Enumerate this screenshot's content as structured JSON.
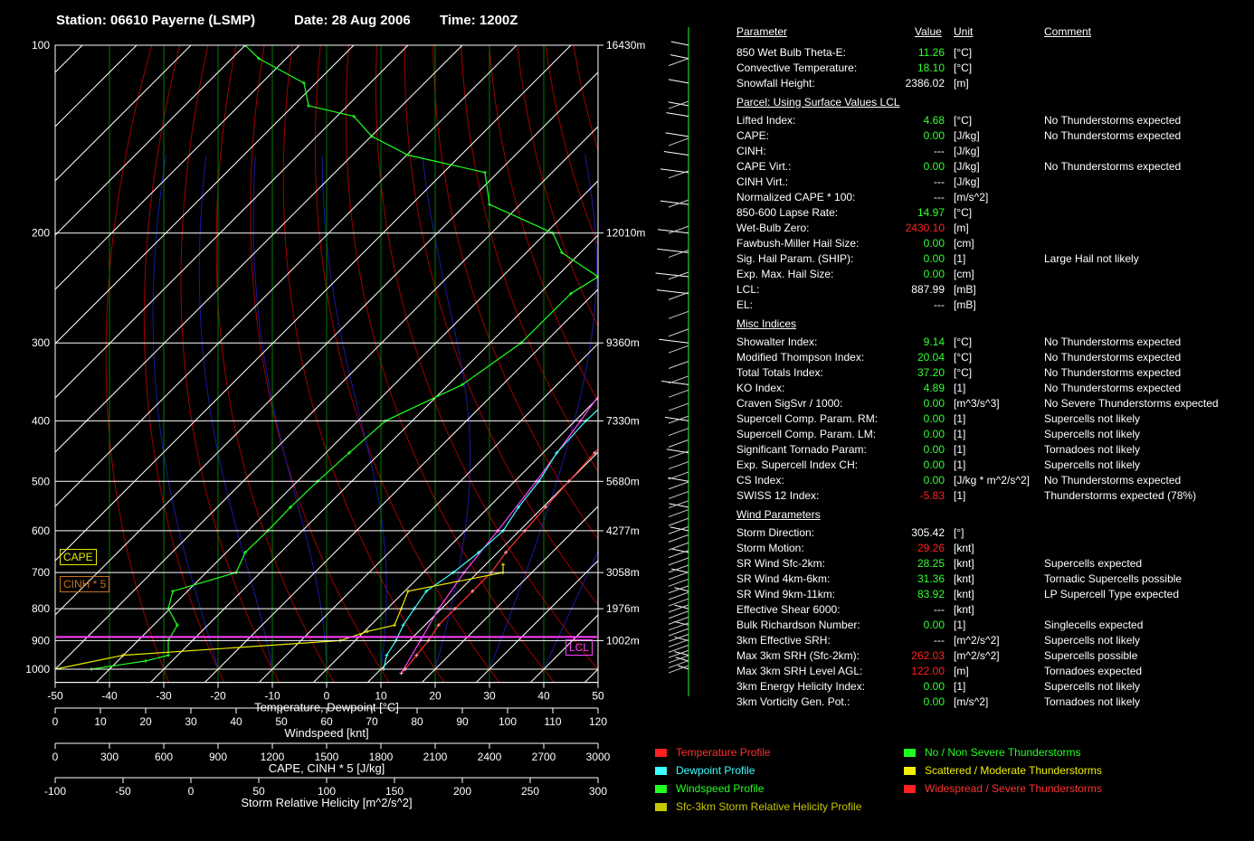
{
  "header": {
    "station": "Station: 06610 Payerne (LSMP)",
    "date": "Date: 28 Aug 2006",
    "time": "Time: 1200Z"
  },
  "colors": {
    "temperature": "#ff3030",
    "dewpoint": "#40ffff",
    "windspeed": "#20ff20",
    "helicity": "#e8e800",
    "parcel": "#ff40ff",
    "isotherm_green": "#007a00",
    "dry_adiabat_red": "#a00000",
    "moist_blue": "#1a1aa0",
    "value_green": "#33ff33",
    "value_red": "#ff2222"
  },
  "chart_data": {
    "type": "line",
    "pressure_levels": [
      100,
      200,
      300,
      400,
      500,
      600,
      700,
      800,
      900,
      1000
    ],
    "height_labels": [
      {
        "p": 100,
        "label": "16430m"
      },
      {
        "p": 200,
        "label": "12010m"
      },
      {
        "p": 300,
        "label": "9360m"
      },
      {
        "p": 400,
        "label": "7330m"
      },
      {
        "p": 500,
        "label": "5680m"
      },
      {
        "p": 600,
        "label": "4277m"
      },
      {
        "p": 700,
        "label": "3058m"
      },
      {
        "p": 800,
        "label": "1976m"
      },
      {
        "p": 900,
        "label": "1002m"
      }
    ],
    "temp_axis": {
      "label": "Temperature, Dewpoint  [°C]",
      "min": -50,
      "max": 50,
      "ticks": [
        -50,
        -40,
        -30,
        -20,
        -10,
        0,
        10,
        20,
        30,
        40,
        50
      ]
    },
    "wind_axis": {
      "label": "Windspeed  [knt]",
      "min": 0,
      "max": 120,
      "ticks": [
        0,
        10,
        20,
        30,
        40,
        50,
        60,
        70,
        80,
        90,
        100,
        110,
        120
      ]
    },
    "cape_axis": {
      "label": "CAPE, CINH * 5  [J/kg]",
      "min": 0,
      "max": 3000,
      "ticks": [
        0,
        300,
        600,
        900,
        1200,
        1500,
        1800,
        2100,
        2400,
        2700,
        3000
      ]
    },
    "srh_axis": {
      "label": "Storm Relative Helicity  [m^2/s^2]",
      "min": -100,
      "max": 300,
      "ticks": [
        -100,
        -50,
        0,
        50,
        100,
        150,
        200,
        250,
        300
      ]
    },
    "temperature": [
      [
        1015,
        14.5
      ],
      [
        1000,
        14.5
      ],
      [
        950,
        14
      ],
      [
        900,
        13.5
      ],
      [
        850,
        12.5
      ],
      [
        800,
        12.5
      ],
      [
        750,
        12.5
      ],
      [
        700,
        12.5
      ],
      [
        650,
        11.5
      ],
      [
        600,
        11.0
      ],
      [
        550,
        10.5
      ],
      [
        500,
        10.0
      ],
      [
        450,
        9.5
      ],
      [
        400,
        9.0
      ],
      [
        350,
        9.0
      ],
      [
        300,
        8.0
      ],
      [
        250,
        8.0
      ],
      [
        225,
        7.5
      ],
      [
        200,
        9.0
      ],
      [
        180,
        12.0
      ],
      [
        160,
        18.0
      ],
      [
        140,
        25.0
      ],
      [
        120,
        35.0
      ],
      [
        105,
        50.0
      ]
    ],
    "dewpoint": [
      [
        1000,
        10.5
      ],
      [
        950,
        8.5
      ],
      [
        900,
        7.5
      ],
      [
        850,
        6.0
      ],
      [
        800,
        5.0
      ],
      [
        750,
        4.0
      ],
      [
        700,
        5.5
      ],
      [
        650,
        6.5
      ],
      [
        600,
        7.0
      ],
      [
        550,
        5.5
      ],
      [
        500,
        4.5
      ],
      [
        450,
        2.5
      ],
      [
        400,
        2.0
      ],
      [
        350,
        2.5
      ],
      [
        300,
        2.5
      ],
      [
        250,
        0.5
      ],
      [
        225,
        0.5
      ],
      [
        200,
        6.0
      ]
    ],
    "parcel": [
      [
        1015,
        14.5
      ],
      [
        900,
        12.0
      ],
      [
        800,
        9.5
      ],
      [
        700,
        7.5
      ],
      [
        600,
        6.0
      ],
      [
        500,
        4.0
      ],
      [
        400,
        1.0
      ],
      [
        300,
        -3.0
      ],
      [
        250,
        -4.5
      ],
      [
        200,
        -4.5
      ],
      [
        150,
        -4.0
      ],
      [
        100,
        -2.5
      ]
    ],
    "windspeed": [
      [
        1000,
        8
      ],
      [
        970,
        20
      ],
      [
        950,
        25
      ],
      [
        900,
        25
      ],
      [
        850,
        27
      ],
      [
        800,
        25
      ],
      [
        750,
        26
      ],
      [
        700,
        40
      ],
      [
        650,
        42
      ],
      [
        600,
        47
      ],
      [
        550,
        52
      ],
      [
        500,
        58
      ],
      [
        450,
        65
      ],
      [
        400,
        73
      ],
      [
        350,
        90
      ],
      [
        300,
        103
      ],
      [
        250,
        114
      ],
      [
        235,
        120
      ],
      [
        215,
        112
      ],
      [
        200,
        110
      ],
      [
        180,
        96
      ],
      [
        160,
        95
      ],
      [
        150,
        78
      ],
      [
        140,
        70
      ],
      [
        130,
        66
      ],
      [
        125,
        56
      ],
      [
        115,
        55
      ],
      [
        105,
        45
      ],
      [
        100,
        42
      ]
    ],
    "helicity": [
      [
        1000,
        -100
      ],
      [
        950,
        -50
      ],
      [
        900,
        110
      ],
      [
        870,
        130
      ],
      [
        850,
        150
      ],
      [
        800,
        155
      ],
      [
        750,
        160
      ],
      [
        700,
        230
      ],
      [
        680,
        230
      ]
    ],
    "lcl_pressure": 887.99,
    "cape_label": "CAPE",
    "cinh_label": "CINH * 5",
    "lcl_label": "LCL"
  },
  "params": {
    "headers": {
      "parameter": "Parameter",
      "value": "Value",
      "unit": "Unit",
      "comment": "Comment"
    },
    "sections": [
      {
        "title": "",
        "rows": [
          {
            "name": "850 Wet Bulb Theta-E:",
            "value": "11.26",
            "unit": "[°C]",
            "comment": "",
            "color": "green"
          },
          {
            "name": "Convective Temperature:",
            "value": "18.10",
            "unit": "[°C]",
            "comment": "",
            "color": "green"
          },
          {
            "name": "Snowfall Height:",
            "value": "2386.02",
            "unit": "[m]",
            "comment": "",
            "color": "white"
          }
        ]
      },
      {
        "title": "Parcel: Using Surface Values LCL",
        "rows": [
          {
            "name": "Lifted Index:",
            "value": "4.68",
            "unit": "[°C]",
            "comment": "No Thunderstorms expected",
            "color": "green"
          },
          {
            "name": "CAPE:",
            "value": "0.00",
            "unit": "[J/kg]",
            "comment": "No Thunderstorms expected",
            "color": "green"
          },
          {
            "name": "CINH:",
            "value": "---",
            "unit": "[J/kg]",
            "comment": "",
            "color": "white"
          },
          {
            "name": "CAPE Virt.:",
            "value": "0.00",
            "unit": "[J/kg]",
            "comment": "No Thunderstorms expected",
            "color": "green"
          },
          {
            "name": "CINH Virt.:",
            "value": "---",
            "unit": "[J/kg]",
            "comment": "",
            "color": "white"
          },
          {
            "name": "Normalized CAPE * 100:",
            "value": "---",
            "unit": "[m/s^2]",
            "comment": "",
            "color": "white"
          },
          {
            "name": "850-600 Lapse Rate:",
            "value": "14.97",
            "unit": "[°C]",
            "comment": "",
            "color": "green"
          },
          {
            "name": "Wet-Bulb Zero:",
            "value": "2430.10",
            "unit": "[m]",
            "comment": "",
            "color": "red"
          },
          {
            "name": "Fawbush-Miller Hail Size:",
            "value": "0.00",
            "unit": "[cm]",
            "comment": "",
            "color": "green"
          },
          {
            "name": "Sig. Hail Param. (SHIP):",
            "value": "0.00",
            "unit": "[1]",
            "comment": "Large Hail not likely",
            "color": "green"
          },
          {
            "name": "Exp. Max. Hail Size:",
            "value": "0.00",
            "unit": "[cm]",
            "comment": "",
            "color": "green"
          },
          {
            "name": "LCL:",
            "value": "887.99",
            "unit": "[mB]",
            "comment": "",
            "color": "white"
          },
          {
            "name": "EL:",
            "value": "---",
            "unit": "[mB]",
            "comment": "",
            "color": "white"
          }
        ]
      },
      {
        "title": "Misc Indices",
        "rows": [
          {
            "name": "Showalter Index:",
            "value": "9.14",
            "unit": "[°C]",
            "comment": "No Thunderstorms expected",
            "color": "green"
          },
          {
            "name": "Modified Thompson Index:",
            "value": "20.04",
            "unit": "[°C]",
            "comment": "No Thunderstorms expected",
            "color": "green"
          },
          {
            "name": "Total Totals Index:",
            "value": "37.20",
            "unit": "[°C]",
            "comment": "No Thunderstorms expected",
            "color": "green"
          },
          {
            "name": "KO Index:",
            "value": "4.89",
            "unit": "[1]",
            "comment": "No Thunderstorms expected",
            "color": "green"
          },
          {
            "name": "Craven SigSvr / 1000:",
            "value": "0.00",
            "unit": "[m^3/s^3]",
            "comment": "No Severe Thunderstorms expected",
            "color": "green"
          },
          {
            "name": "Supercell Comp. Param. RM:",
            "value": "0.00",
            "unit": "[1]",
            "comment": "Supercells not likely",
            "color": "green"
          },
          {
            "name": "Supercell Comp. Param. LM:",
            "value": "0.00",
            "unit": "[1]",
            "comment": "Supercells not likely",
            "color": "green"
          },
          {
            "name": "Significant Tornado Param:",
            "value": "0.00",
            "unit": "[1]",
            "comment": "Tornadoes not likely",
            "color": "green"
          },
          {
            "name": "Exp. Supercell Index CH:",
            "value": "0.00",
            "unit": "[1]",
            "comment": "Supercells not likely",
            "color": "green"
          },
          {
            "name": "CS Index:",
            "value": "0.00",
            "unit": "[J/kg * m^2/s^2]",
            "comment": "No Thunderstorms expected",
            "color": "green"
          },
          {
            "name": "SWISS 12 Index:",
            "value": "-5.83",
            "unit": "[1]",
            "comment": "Thunderstorms expected (78%)",
            "color": "red"
          }
        ]
      },
      {
        "title": "Wind Parameters",
        "rows": [
          {
            "name": "Storm Direction:",
            "value": "305.42",
            "unit": "[°]",
            "comment": "",
            "color": "white"
          },
          {
            "name": "Storm Motion:",
            "value": "29.26",
            "unit": "[knt]",
            "comment": "",
            "color": "red"
          },
          {
            "name": "SR Wind Sfc-2km:",
            "value": "28.25",
            "unit": "[knt]",
            "comment": "Supercells expected",
            "color": "green"
          },
          {
            "name": "SR Wind 4km-6km:",
            "value": "31.36",
            "unit": "[knt]",
            "comment": "Tornadic Supercells possible",
            "color": "green"
          },
          {
            "name": "SR Wind 9km-11km:",
            "value": "83.92",
            "unit": "[knt]",
            "comment": "LP Supercell Type expected",
            "color": "green"
          },
          {
            "name": "Effective Shear 6000:",
            "value": "---",
            "unit": "[knt]",
            "comment": "",
            "color": "white"
          },
          {
            "name": "Bulk Richardson Number:",
            "value": "0.00",
            "unit": "[1]",
            "comment": "Singlecells expected",
            "color": "green"
          },
          {
            "name": "3km Effective SRH:",
            "value": "---",
            "unit": "[m^2/s^2]",
            "comment": "Supercells not likely",
            "color": "white"
          },
          {
            "name": "Max 3km SRH (Sfc-2km):",
            "value": "262.03",
            "unit": "[m^2/s^2]",
            "comment": "Supercells possible",
            "color": "red"
          },
          {
            "name": "Max 3km SRH Level AGL:",
            "value": "122.00",
            "unit": "[m]",
            "comment": "Tornadoes expected",
            "color": "red"
          },
          {
            "name": "3km Energy Helicity Index:",
            "value": "0.00",
            "unit": "[1]",
            "comment": "Supercells not likely",
            "color": "green"
          },
          {
            "name": "3km Vorticity Gen. Pot.:",
            "value": "0.00",
            "unit": "[m/s^2]",
            "comment": "Tornadoes not likely",
            "color": "green"
          }
        ]
      }
    ]
  },
  "legend": {
    "left": [
      {
        "label": "Temperature Profile",
        "color": "#ff2020",
        "text_color": "#ff3030"
      },
      {
        "label": "Dewpoint Profile",
        "color": "#40ffff",
        "text_color": "#40ffff"
      },
      {
        "label": "Windspeed Profile",
        "color": "#20ff20",
        "text_color": "#20ff20"
      },
      {
        "label": "Sfc-3km Storm Relative Helicity Profile",
        "color": "#c8c800",
        "text_color": "#c8c800"
      }
    ],
    "right": [
      {
        "label": "No / Non Severe Thunderstorms",
        "color": "#20ff20",
        "text_color": "#20ff20"
      },
      {
        "label": "Scattered / Moderate Thunderstorms",
        "color": "#f0f000",
        "text_color": "#f0f000"
      },
      {
        "label": "Widespread / Severe Thunderstorms",
        "color": "#ff2020",
        "text_color": "#ff3030"
      }
    ]
  }
}
